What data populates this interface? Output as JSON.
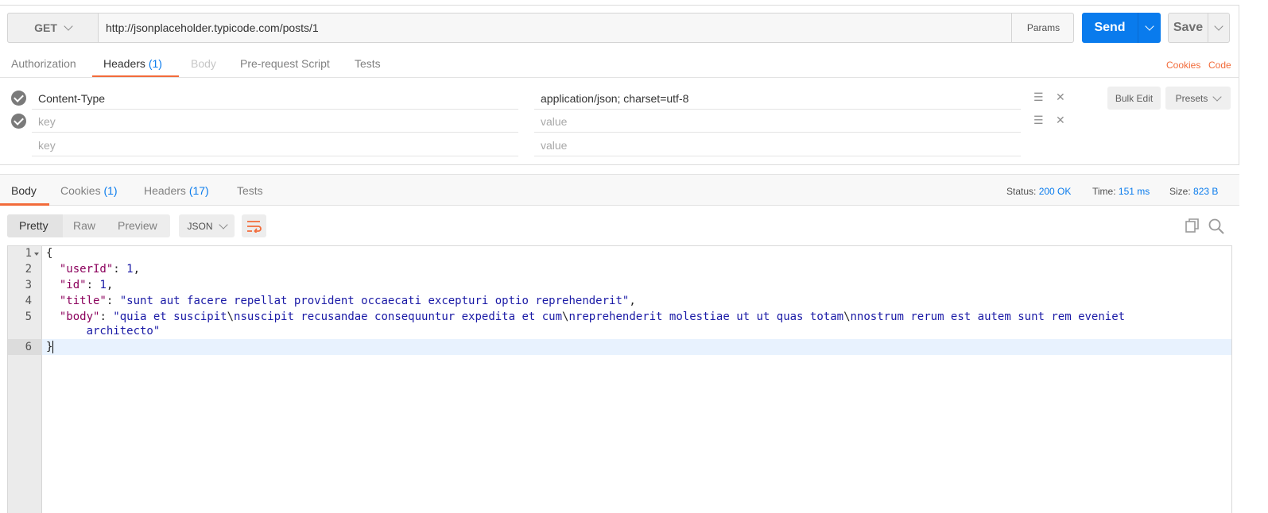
{
  "request": {
    "method": "GET",
    "url": "http://jsonplaceholder.typicode.com/posts/1",
    "params_label": "Params",
    "send_label": "Send",
    "save_label": "Save"
  },
  "request_tabs": [
    {
      "label": "Authorization"
    },
    {
      "label": "Headers",
      "count": "(1)"
    },
    {
      "label": "Body"
    },
    {
      "label": "Pre-request Script"
    },
    {
      "label": "Tests"
    }
  ],
  "links": {
    "cookies": "Cookies",
    "code": "Code"
  },
  "headers": {
    "rows": [
      {
        "key": "Content-Type",
        "value": "application/json; charset=utf-8"
      },
      {
        "key": "key",
        "value": "value"
      },
      {
        "key": "key",
        "value": "value"
      }
    ],
    "bulk_edit_label": "Bulk Edit",
    "presets_label": "Presets"
  },
  "response_tabs": [
    {
      "label": "Body"
    },
    {
      "label": "Cookies",
      "count": "(1)"
    },
    {
      "label": "Headers",
      "count": "(17)"
    },
    {
      "label": "Tests"
    }
  ],
  "status": {
    "status_label": "Status:",
    "status_value": "200 OK",
    "time_label": "Time:",
    "time_value": "151 ms",
    "size_label": "Size:",
    "size_value": "823 B"
  },
  "format": {
    "pretty": "Pretty",
    "raw": "Raw",
    "preview": "Preview",
    "type": "JSON"
  },
  "code": {
    "line_numbers": [
      "1",
      "2",
      "3",
      "4",
      "5",
      "6"
    ],
    "brace_open": "{",
    "brace_close": "}",
    "userId_key": "\"userId\"",
    "userId_val": "1",
    "id_key": "\"id\"",
    "id_val": "1",
    "title_key": "\"title\"",
    "title_val": "\"sunt aut facere repellat provident occaecati excepturi optio reprehenderit\"",
    "body_key": "\"body\"",
    "body_val_1": "\"quia et suscipit",
    "body_val_2": "nsuscipit recusandae consequuntur expedita et cum",
    "body_val_3": "nreprehenderit molestiae ut ut quas totam",
    "body_val_4": "nnostrum rerum est autem sunt rem eveniet",
    "body_val_5": "architecto\"",
    "backslash": "\\"
  },
  "colors": {
    "accent": "#097bed",
    "tab_underline": "#f26b3a"
  }
}
